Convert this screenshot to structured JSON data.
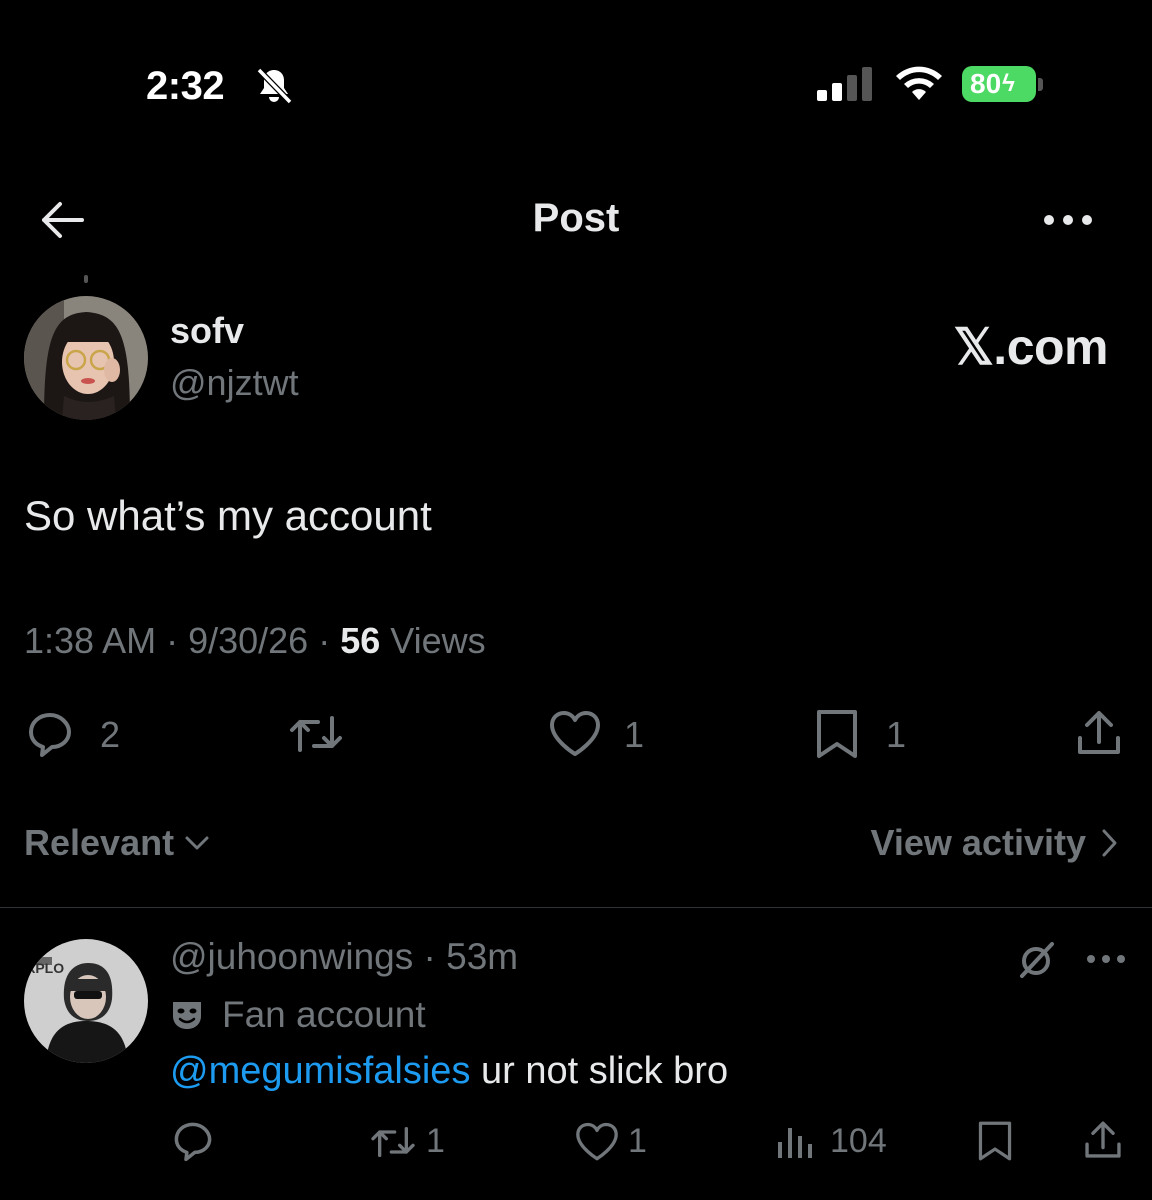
{
  "status_bar": {
    "time": "2:32",
    "battery": "80"
  },
  "header": {
    "title": "Post"
  },
  "post": {
    "author_name": "sofv",
    "author_handle": "@njztwt",
    "watermark": "𝕏.com",
    "text": "So what’s my account",
    "time": "1:38 AM",
    "separator": " · ",
    "date": "9/30/26",
    "views_count": "56",
    "views_label": " Views",
    "replies": "2",
    "likes": "1",
    "bookmarks": "1"
  },
  "sort": {
    "label": "Relevant",
    "activity": "View activity"
  },
  "reply": {
    "handle": "@juhoonwings",
    "separator": " · ",
    "time": "53m",
    "badge": "Fan account",
    "mention": "@megumisfalsies",
    "text": " ur not slick bro",
    "reposts": "1",
    "likes": "1",
    "views": "104"
  },
  "colors": {
    "background": "#000000",
    "text": "#e7e9ea",
    "muted": "#71767b",
    "link": "#1d9bf0",
    "battery": "#4cd964"
  },
  "icons": [
    "back-arrow-icon",
    "more-icon",
    "reply-icon",
    "repost-icon",
    "like-icon",
    "bookmark-icon",
    "share-icon",
    "chevron-down-icon",
    "chevron-right-icon",
    "views-icon",
    "grok-icon",
    "theater-mask-icon",
    "bell-slash-icon",
    "signal-icon",
    "wifi-icon",
    "battery-icon"
  ]
}
